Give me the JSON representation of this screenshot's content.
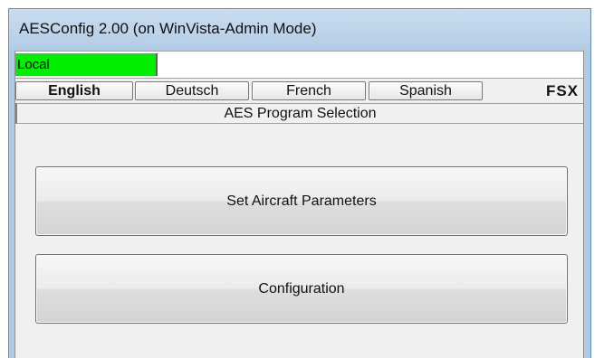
{
  "window": {
    "title": "AESConfig 2.00 (on WinVista-Admin Mode)"
  },
  "status": {
    "mode_label": "Local",
    "mode_color": "#00ee00"
  },
  "languages": {
    "items": [
      "English",
      "Deutsch",
      "French",
      "Spanish"
    ],
    "selected": "English",
    "sim_label": "FSX"
  },
  "section": {
    "title": "AES Program Selection"
  },
  "actions": {
    "set_aircraft_label": "Set Aircraft Parameters",
    "configuration_label": "Configuration"
  }
}
